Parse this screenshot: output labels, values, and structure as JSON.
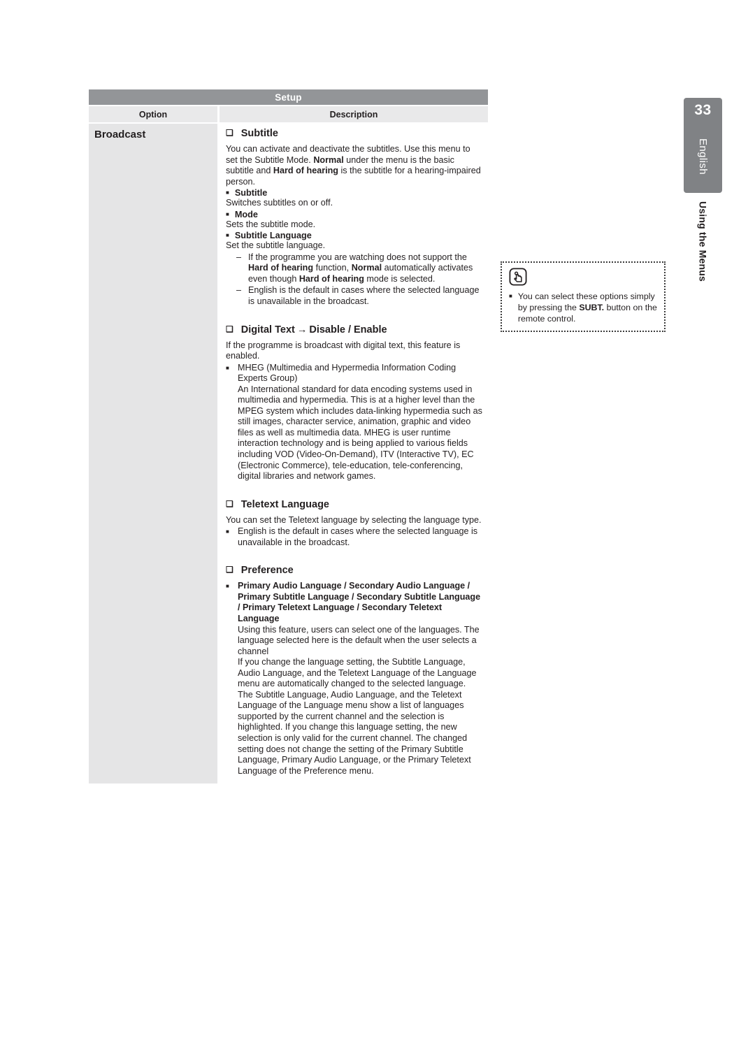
{
  "table": {
    "title": "Setup",
    "headers": {
      "option": "Option",
      "description": "Description"
    },
    "option_label": "Broadcast"
  },
  "sections": {
    "subtitle": {
      "marker": "❑",
      "heading": "Subtitle",
      "intro_1": "You can activate and deactivate the subtitles. Use this menu to set the Subtitle Mode. ",
      "intro_b1": "Normal",
      "intro_2": " under the menu is the basic subtitle and ",
      "intro_b2": "Hard of hearing",
      "intro_3": " is the subtitle for a hearing-impaired person.",
      "sub_1_marker": "■",
      "sub_1_title": "Subtitle",
      "sub_1_text": "Switches subtitles on or off.",
      "sub_2_marker": "■",
      "sub_2_title": "Mode",
      "sub_2_text": "Sets the subtitle mode.",
      "sub_3_marker": "■",
      "sub_3_title": "Subtitle Language",
      "sub_3_text": "Set the subtitle language.",
      "dash_marker": "–",
      "dash_1_a": "If the programme you are watching does not support the ",
      "dash_1_b1": "Hard of hearing",
      "dash_1_b": " function, ",
      "dash_1_b2": "Normal",
      "dash_1_c": " automatically activates even though ",
      "dash_1_b3": "Hard of hearing",
      "dash_1_d": " mode is selected.",
      "dash_2": "English is the default in cases where the selected language is unavailable in the broadcast."
    },
    "digital_text": {
      "marker": "❑",
      "heading_1": "Digital Text",
      "arrow": "→",
      "heading_2": "Disable / Enable",
      "intro": "If the programme is broadcast with digital text, this feature is enabled.",
      "bullet_marker": "■",
      "bullet_title": "MHEG (Multimedia and Hypermedia Information Coding Experts Group)",
      "bullet_body": "An International standard for data encoding systems used in multimedia and hypermedia. This is at a higher level than the MPEG system which includes data-linking hypermedia such as still images, character service, animation, graphic and video files as well as multimedia data. MHEG is user runtime interaction technology and is being applied to various fields including VOD (Video-On-Demand), ITV (Interactive TV), EC (Electronic Commerce), tele-education, tele-conferencing, digital libraries and network games."
    },
    "teletext_language": {
      "marker": "❑",
      "heading": "Teletext Language",
      "intro": "You can set the Teletext language by selecting the language type.",
      "bullet_marker": "■",
      "bullet_text": "English is the default in cases where the selected language is unavailable in the broadcast."
    },
    "preference": {
      "marker": "❑",
      "heading": "Preference",
      "bullet_marker": "■",
      "bullet_title": "Primary Audio Language / Secondary Audio Language / Primary Subtitle Language / Secondary Subtitle Language / Primary Teletext Language / Secondary Teletext Language",
      "body_1": "Using this feature, users can select one of the languages. The language selected here is the default when the user selects a channel",
      "body_2": "If you change the language setting, the Subtitle Language, Audio Language, and the Teletext Language of the Language menu are automatically changed to the selected language.",
      "body_3": "The Subtitle Language, Audio Language, and the Teletext Language of the Language menu show a list of languages supported by the current channel and the selection is highlighted. If you change this language setting, the new selection is only valid for the current channel. The changed setting does not change the setting of the Primary Subtitle Language, Primary Audio Language, or the Primary Teletext Language of the Preference menu."
    }
  },
  "note": {
    "icon_name": "hand-press-button-icon",
    "marker": "■",
    "text_1": "You can select these options simply by pressing the ",
    "text_bold": "SUBT.",
    "text_2": " button on the remote control."
  },
  "sidebar": {
    "page_number": "33",
    "language": "English",
    "chapter": "Using the Menus"
  },
  "colors": {
    "setup_bar": "#939598",
    "column_header": "#e9e9ea",
    "option_cell": "#e5e5e6",
    "side_tab": "#808285",
    "text": "#231f20"
  }
}
